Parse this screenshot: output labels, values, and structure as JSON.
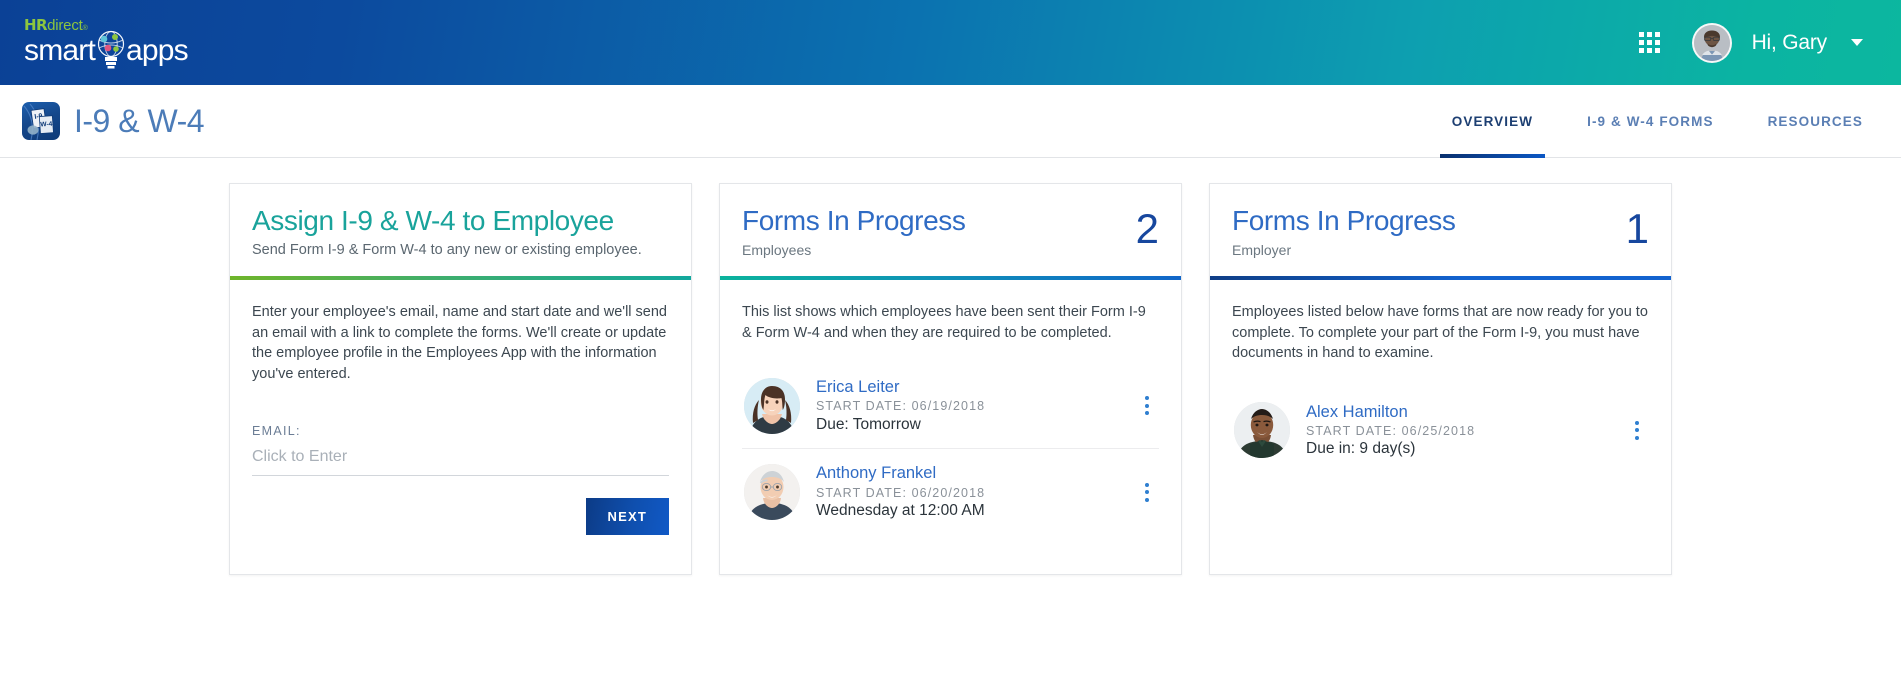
{
  "header": {
    "logo": {
      "hr": "HR",
      "direct": "direct",
      "smart": "smart",
      "apps": "apps"
    },
    "grid_icon": "apps-grid-icon",
    "greeting": "Hi, Gary",
    "caret_icon": "chevron-down-icon"
  },
  "appbar": {
    "app_icon_labels": {
      "top": "I-9",
      "bottom": "W-4"
    },
    "title": "I-9 & W-4",
    "tabs": [
      {
        "label": "OVERVIEW",
        "active": true
      },
      {
        "label": "I-9 & W-4 FORMS",
        "active": false
      },
      {
        "label": "RESOURCES",
        "active": false
      }
    ]
  },
  "cards": [
    {
      "title": "Assign I-9 & W-4 to Employee",
      "subtitle": "Send Form I-9 & Form W-4 to any new or existing employee.",
      "body": "Enter your employee's email, name and start date and we'll send an email with a link to complete the forms. We'll create or update the employee profile in the Employees App with the information you've entered.",
      "field_label": "EMAIL:",
      "field_placeholder": "Click to Enter",
      "field_value": "",
      "button_label": "NEXT"
    },
    {
      "title": "Forms In Progress",
      "subtitle": "Employees",
      "count": "2",
      "body": "This list shows which employees have been sent their Form I-9 & Form W-4 and when they are required to be completed.",
      "people": [
        {
          "name": "Erica Leiter",
          "start_date": "START DATE: 06/19/2018",
          "due": "Due: Tomorrow",
          "menu_icon": "kebab-menu-icon"
        },
        {
          "name": "Anthony Frankel",
          "start_date": "START DATE: 06/20/2018",
          "due": "Wednesday at 12:00 AM",
          "menu_icon": "kebab-menu-icon"
        }
      ]
    },
    {
      "title": "Forms In Progress",
      "subtitle": "Employer",
      "count": "1",
      "body": "Employees listed below have forms that are now ready for you to complete. To complete your part of the Form I-9, you must have documents in hand to examine.",
      "people": [
        {
          "name": "Alex Hamilton",
          "start_date": "START DATE: 06/25/2018",
          "due": "Due in: 9 day(s)",
          "menu_icon": "kebab-menu-icon"
        }
      ]
    }
  ],
  "colors": {
    "header_start": "#0b4196",
    "header_end": "#0cb79f",
    "accent_teal": "#19a39b",
    "accent_blue": "#2f6bc4",
    "count_blue": "#17479e",
    "button_blue": "#0f4fae",
    "logo_green": "#8dc63f"
  }
}
